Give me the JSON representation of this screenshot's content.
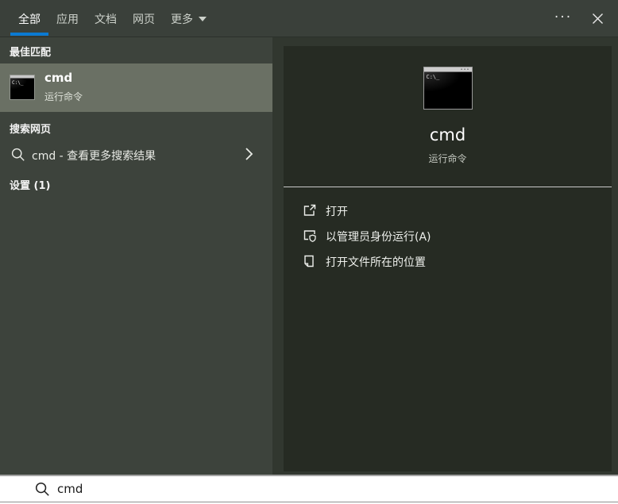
{
  "colors": {
    "accent": "#0b7ad1",
    "header_bg": "#3a403a",
    "left_panel_bg": "#3d433c",
    "highlight_row_bg": "#6a7064",
    "right_outer_bg": "#31372f",
    "right_inner_bg": "#262b23",
    "search_bar_bg": "#ffffff"
  },
  "header": {
    "tabs": [
      {
        "label": "全部",
        "active": true
      },
      {
        "label": "应用",
        "active": false
      },
      {
        "label": "文档",
        "active": false
      },
      {
        "label": "网页",
        "active": false
      },
      {
        "label": "更多",
        "active": false,
        "dropdown": true
      }
    ],
    "more_options_glyph": "···"
  },
  "left_panel": {
    "best_match": {
      "header": "最佳匹配",
      "item": {
        "title": "cmd",
        "subtitle": "运行命令",
        "icon_text": "C:\\_"
      }
    },
    "search_web": {
      "header": "搜索网页",
      "item": {
        "label": "cmd - 查看更多搜索结果"
      }
    },
    "settings": {
      "header": "设置 (1)"
    }
  },
  "right_panel": {
    "title": "cmd",
    "subtitle": "运行命令",
    "icon_text": "C:\\_",
    "actions": [
      {
        "label": "打开"
      },
      {
        "label": "以管理员身份运行(A)"
      },
      {
        "label": "打开文件所在的位置"
      }
    ]
  },
  "search_bar": {
    "value": "cmd"
  }
}
